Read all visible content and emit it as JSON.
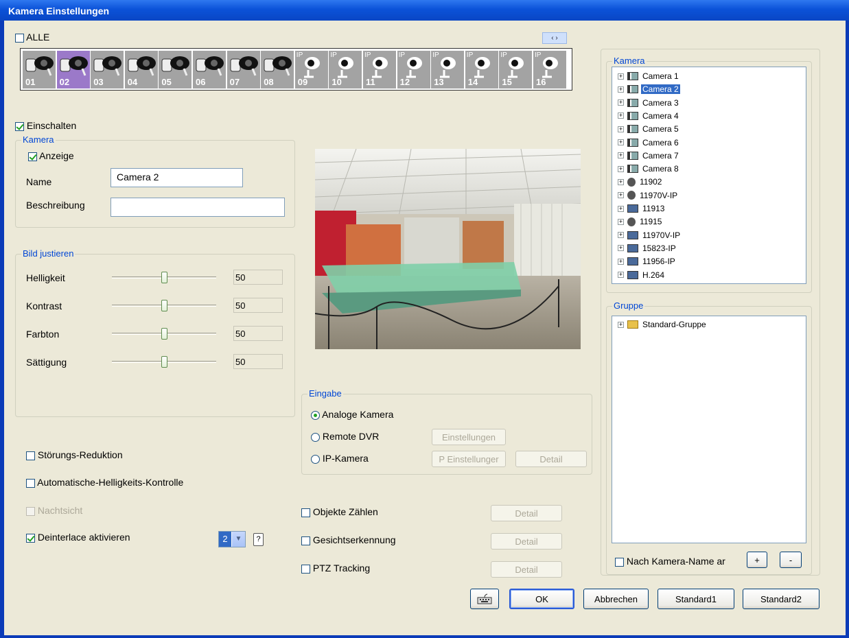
{
  "window": {
    "title": "Kamera Einstellungen"
  },
  "all_label": "ALLE",
  "camera_strip": [
    {
      "num": "01",
      "ip": ""
    },
    {
      "num": "02",
      "ip": ""
    },
    {
      "num": "03",
      "ip": ""
    },
    {
      "num": "04",
      "ip": ""
    },
    {
      "num": "05",
      "ip": ""
    },
    {
      "num": "06",
      "ip": ""
    },
    {
      "num": "07",
      "ip": ""
    },
    {
      "num": "08",
      "ip": ""
    },
    {
      "num": "09",
      "ip": "IP"
    },
    {
      "num": "10",
      "ip": "IP"
    },
    {
      "num": "11",
      "ip": "IP"
    },
    {
      "num": "12",
      "ip": "IP"
    },
    {
      "num": "13",
      "ip": "IP"
    },
    {
      "num": "14",
      "ip": "IP"
    },
    {
      "num": "15",
      "ip": "IP"
    },
    {
      "num": "16",
      "ip": "IP"
    }
  ],
  "strip_arrows": "‹ ›",
  "enable_label": "Einschalten",
  "camera_group": {
    "title": "Kamera",
    "display_label": "Anzeige",
    "name_label": "Name",
    "name_value": "Camera 2",
    "description_label": "Beschreibung",
    "description_value": ""
  },
  "image_adjust": {
    "title": "Bild justieren",
    "sliders": [
      {
        "label": "Helligkeit",
        "value": "50"
      },
      {
        "label": "Kontrast",
        "value": "50"
      },
      {
        "label": "Farbton",
        "value": "50"
      },
      {
        "label": "Sättigung",
        "value": "50"
      }
    ]
  },
  "options": {
    "noise_reduction": "Störungs-Reduktion",
    "auto_brightness": "Automatische-Helligkeits-Kontrolle",
    "night_vision": "Nachtsicht",
    "deinterlace": "Deinterlace aktivieren",
    "deinterlace_value": "2",
    "help": "?"
  },
  "input_group": {
    "title": "Eingabe",
    "analog": "Analoge Kamera",
    "remote_dvr": "Remote DVR",
    "ip_camera": "IP-Kamera",
    "settings_btn": "Einstellungen",
    "ip_settings_btn": "P Einstellunger",
    "detail_btn": "Detail"
  },
  "features": [
    {
      "label": "Objekte Zählen",
      "btn": "Detail"
    },
    {
      "label": "Gesichtserkennung",
      "btn": "Detail"
    },
    {
      "label": "PTZ Tracking",
      "btn": "Detail"
    }
  ],
  "camera_tree": {
    "title": "Kamera",
    "items": [
      {
        "label": "Camera 1",
        "icon": "analog-camera-icon"
      },
      {
        "label": "Camera 2",
        "icon": "analog-camera-icon"
      },
      {
        "label": "Camera 3",
        "icon": "analog-camera-icon"
      },
      {
        "label": "Camera 4",
        "icon": "analog-camera-icon"
      },
      {
        "label": "Camera 5",
        "icon": "analog-camera-icon"
      },
      {
        "label": "Camera 6",
        "icon": "analog-camera-icon"
      },
      {
        "label": "Camera 7",
        "icon": "analog-camera-icon"
      },
      {
        "label": "Camera 8",
        "icon": "analog-camera-icon"
      },
      {
        "label": "11902",
        "icon": "ip-dome-icon"
      },
      {
        "label": "11970V-IP",
        "icon": "ip-dome-icon"
      },
      {
        "label": "11913",
        "icon": "ip-camera-icon"
      },
      {
        "label": "11915",
        "icon": "ip-dome-icon"
      },
      {
        "label": "11970V-IP",
        "icon": "ip-camera-icon"
      },
      {
        "label": "15823-IP",
        "icon": "ip-camera-icon"
      },
      {
        "label": "11956-IP",
        "icon": "ip-camera-icon"
      },
      {
        "label": "H.264",
        "icon": "ip-camera-icon"
      }
    ]
  },
  "group_tree": {
    "title": "Gruppe",
    "items": [
      {
        "label": "Standard-Gruppe",
        "icon": "folder-icon"
      }
    ],
    "sort_label": "Nach Kamera-Name ar",
    "add_btn": "+",
    "remove_btn": "-"
  },
  "footer": {
    "ok": "OK",
    "cancel": "Abbrechen",
    "default1": "Standard1",
    "default2": "Standard2"
  }
}
